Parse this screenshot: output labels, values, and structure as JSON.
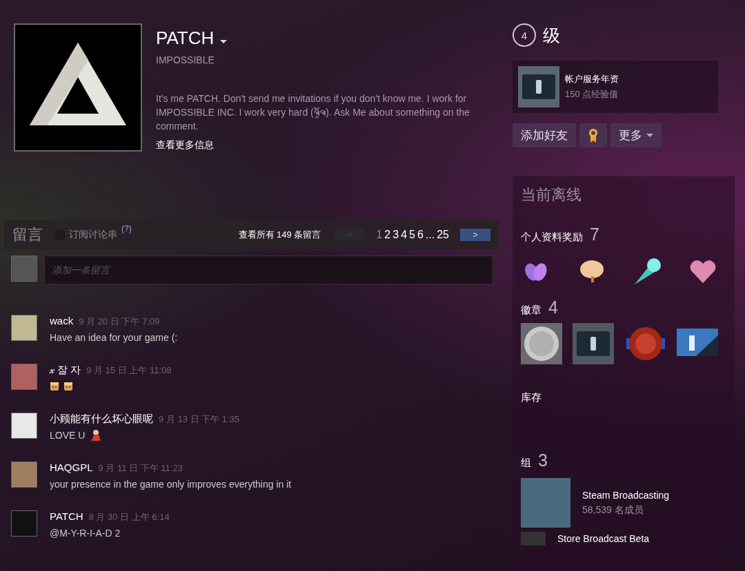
{
  "profile": {
    "name": "PATCH",
    "real_name": "IMPOSSIBLE",
    "summary": "It's me PATCH. Don't send me invitations if you don't know me. I work for IMPOSSIBLE INC. I work very hard (ຈູ້ຈ). Ask Me about something on the comment.",
    "more_info": "查看更多信息"
  },
  "level": {
    "number": "4",
    "label": "级"
  },
  "featured_badge": {
    "title": "帐户服务年资",
    "xp": "150 点经验值"
  },
  "actions": [
    {
      "kind": "text",
      "label": "添加好友"
    },
    {
      "kind": "award"
    },
    {
      "kind": "dropdown",
      "label": "更多"
    }
  ],
  "comments_header": {
    "title": "留言",
    "subscribe": {
      "label": "订阅讨论串",
      "checked": false,
      "help": "(?)"
    },
    "view_all": "查看所有 149 条留言",
    "prev": {
      "label": "<",
      "disabled": true
    },
    "next": {
      "label": ">",
      "disabled": false
    },
    "pages": [
      {
        "label": "1",
        "selected": true
      },
      {
        "label": "2",
        "selected": false
      },
      {
        "label": "3",
        "selected": false
      },
      {
        "label": "4",
        "selected": false
      },
      {
        "label": "5",
        "selected": false
      },
      {
        "label": "6",
        "selected": false
      },
      {
        "label": "...",
        "selected": false
      },
      {
        "label": "25",
        "selected": false
      }
    ]
  },
  "comment_input": {
    "placeholder": "添加一条留言"
  },
  "comments": [
    {
      "author": "wack",
      "time": "9 月 20 日 下午 7:09",
      "text": "Have an idea for your game (:"
    },
    {
      "author": "𝓍 잘 자",
      "time": "9 月 15 日 上午 11:08",
      "emoticons": [
        {
          "kind": "face"
        },
        {
          "kind": "face"
        }
      ]
    },
    {
      "author": "小顾能有什么坏心眼呢",
      "time": "9 月 13 日 下午 1:35",
      "text": "LOVE U",
      "emoticons": [
        {
          "kind": "figure"
        }
      ]
    },
    {
      "author": "HAQGPL",
      "time": "9 月 11 日 下午 11:23",
      "text": "your presence in the game only improves everything in it"
    },
    {
      "author": "PATCH",
      "time": "8 月 30 日 上午 6:14",
      "text": "@M-Y-R-I-A-D 2"
    }
  ],
  "sidebar": {
    "status": "当前离线",
    "rewards": {
      "title": "个人资料奖励",
      "count": "7",
      "items": [
        {
          "kind": "hands"
        },
        {
          "kind": "brain"
        },
        {
          "kind": "comet"
        },
        {
          "kind": "heart"
        }
      ]
    },
    "badges": {
      "title": "徽章",
      "count": "4",
      "items": [
        {
          "kind": "coin"
        },
        {
          "kind": "years"
        },
        {
          "kind": "seal"
        },
        {
          "kind": "ribbon"
        }
      ]
    },
    "inventory": {
      "title": "库存"
    },
    "groups": {
      "title": "组",
      "count": "3",
      "items": [
        {
          "name": "Steam Broadcasting",
          "members": "58,539 名成员"
        },
        {
          "name": "Store Broadcast Beta"
        }
      ]
    }
  }
}
